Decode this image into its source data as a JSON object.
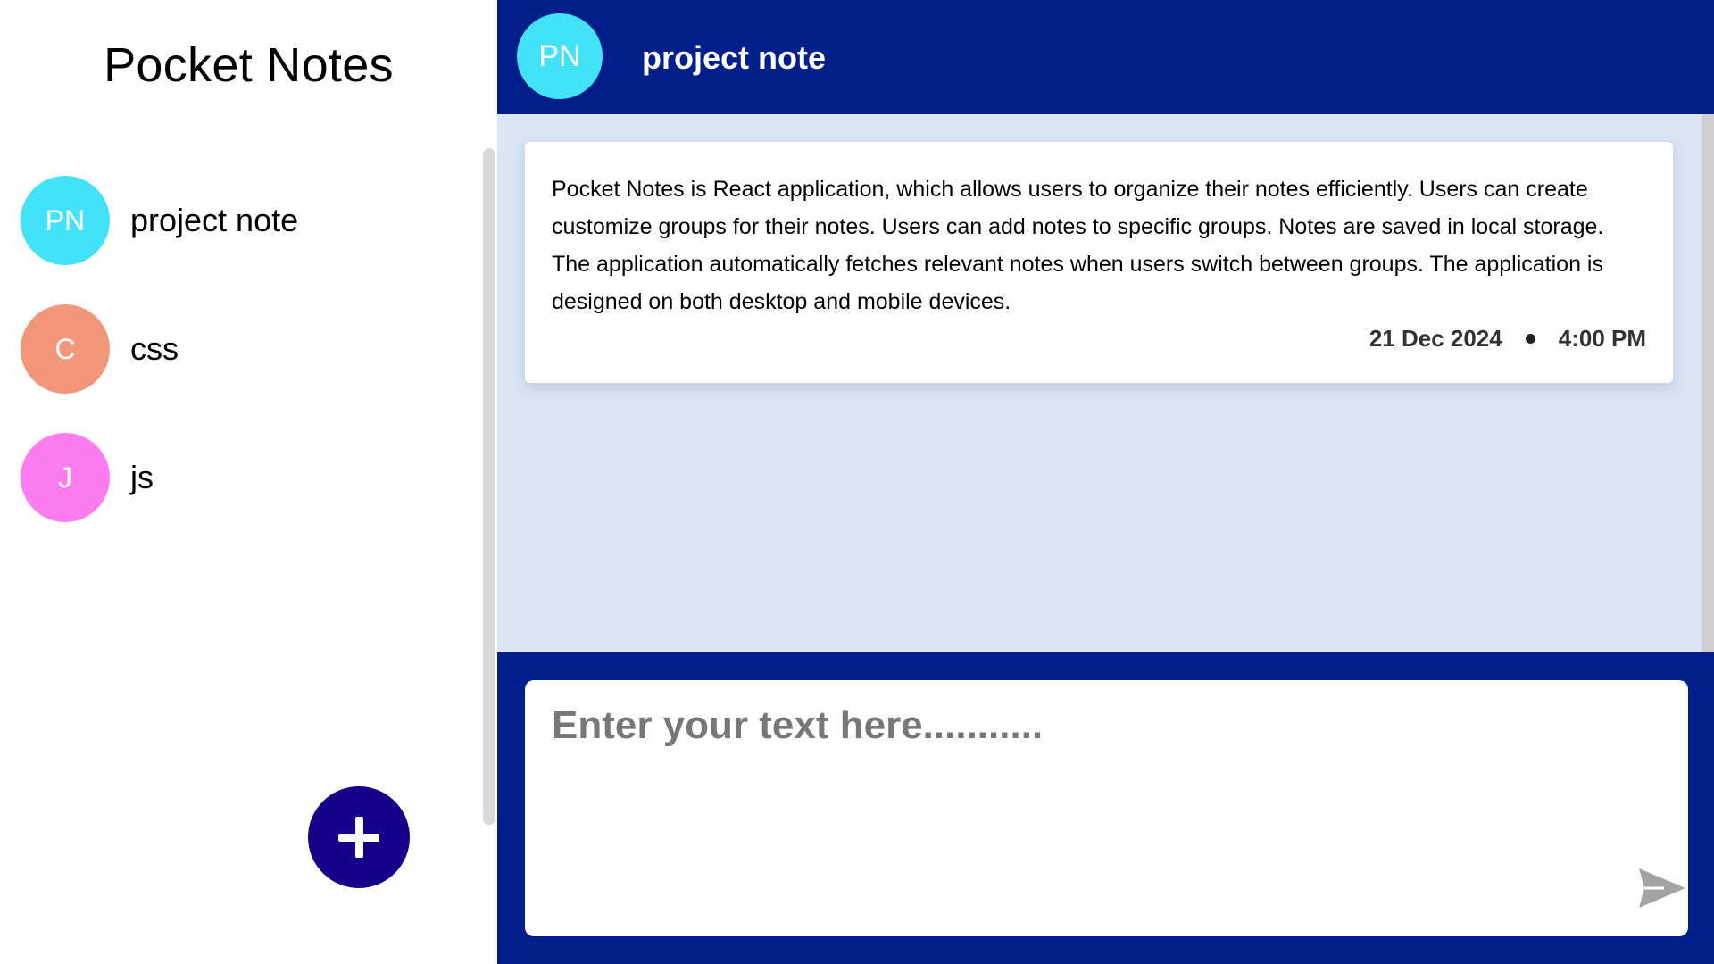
{
  "app": {
    "title": "Pocket Notes"
  },
  "sidebar": {
    "groups": [
      {
        "initials": "PN",
        "name": "project note",
        "color": "#42e3f9"
      },
      {
        "initials": "C",
        "name": "css",
        "color": "#f3977b"
      },
      {
        "initials": "J",
        "name": "js",
        "color": "#fd7cef"
      }
    ],
    "add_button_icon": "plus-icon"
  },
  "header": {
    "initials": "PN",
    "title": "project note",
    "color": "#42e3f9"
  },
  "notes": [
    {
      "text": "Pocket Notes is React application, which allows users to organize their notes efficiently. Users can create customize groups for their notes. Users can add notes to specific groups. Notes are saved in local storage. The application automatically fetches relevant notes when users switch between groups. The application is designed on both desktop and mobile devices.",
      "date": "21 Dec 2024",
      "time": "4:00 PM"
    }
  ],
  "composer": {
    "placeholder": "Enter your text here...........",
    "send_icon": "send-icon"
  },
  "colors": {
    "primary": "#001f8b",
    "add_button": "#16008b",
    "notes_background": "#dae5f5"
  }
}
